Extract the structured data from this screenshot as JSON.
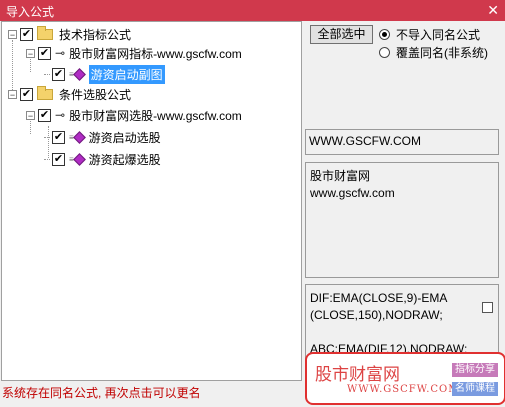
{
  "window": {
    "title": "导入公式",
    "close_glyph": "✕"
  },
  "tree": {
    "items": [
      {
        "label": "技术指标公式",
        "checked": true,
        "icon": "folder-icon",
        "expander": "−"
      },
      {
        "label": "股市财富网指标-www.gscfw.com",
        "checked": true,
        "icon": "key-icon",
        "expander": "−"
      },
      {
        "label": "游资启动副图",
        "checked": true,
        "icon": "formula-icon",
        "selected": true
      },
      {
        "label": "条件选股公式",
        "checked": true,
        "icon": "folder-icon",
        "expander": "−"
      },
      {
        "label": "股市财富网选股-www.gscfw.com",
        "checked": true,
        "icon": "key-icon",
        "expander": "−"
      },
      {
        "label": "游资启动选股",
        "checked": true,
        "icon": "formula-icon"
      },
      {
        "label": "游资起爆选股",
        "checked": true,
        "icon": "formula-icon"
      }
    ]
  },
  "options": {
    "select_all_label": "全部选中",
    "radio_no_import": "不导入同名公式",
    "radio_overwrite": "覆盖同名(非系统)",
    "selected_radio": "no_import"
  },
  "info": {
    "url": "WWW.GSCFW.COM",
    "desc_line1": "股市财富网",
    "desc_line2": "www.gscfw.com",
    "code_line1": "DIF:EMA(CLOSE,9)-EMA",
    "code_line2": "(CLOSE,150),NODRAW;",
    "code_line3": "ABC:EMA(DIF,12),NODRAW;"
  },
  "status_text": "系统存在同名公式, 再次点击可以更名",
  "watermark": {
    "name": "股市财富网",
    "url": "WWW.GSCFW.COM",
    "tag1": "指标分享",
    "tag2": "名师课程"
  },
  "colors": {
    "titlebar": "#d0394c",
    "selection": "#3399ff",
    "status": "#c00000",
    "watermark_border": "#e03030"
  }
}
